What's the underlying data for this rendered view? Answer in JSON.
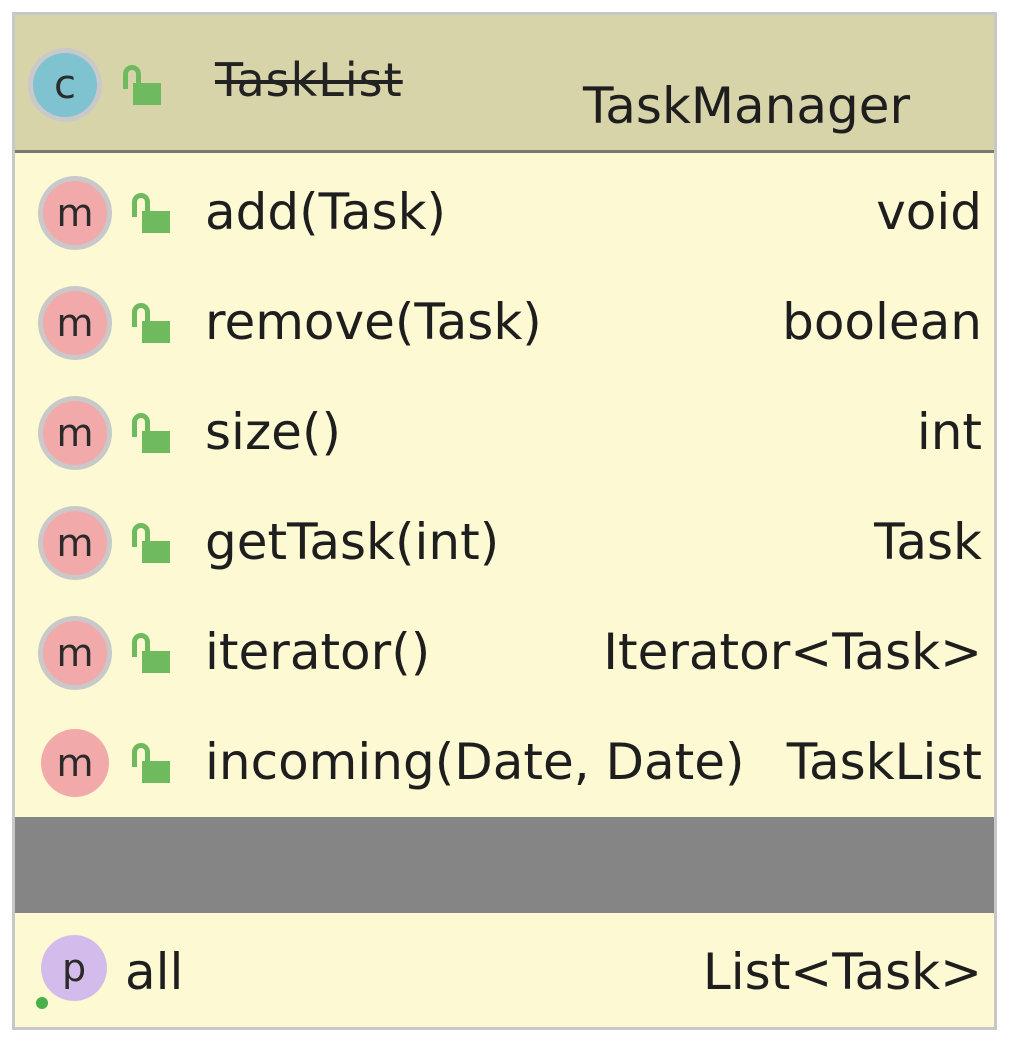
{
  "header": {
    "kind_letter": "c",
    "old_name": "TaskList",
    "name": "TaskManager"
  },
  "methods": [
    {
      "icon": "m",
      "name": "add(Task)",
      "type": "void"
    },
    {
      "icon": "m",
      "name": "remove(Task)",
      "type": "boolean"
    },
    {
      "icon": "m",
      "name": "size()",
      "type": "int"
    },
    {
      "icon": "m",
      "name": "getTask(int)",
      "type": "Task"
    },
    {
      "icon": "m",
      "name": "iterator()",
      "type": "Iterator<Task>"
    },
    {
      "icon": "m",
      "name": "incoming(Date, Date)",
      "type": "TaskList"
    }
  ],
  "properties": [
    {
      "icon": "p",
      "name": "all",
      "type": "List<Task>"
    }
  ],
  "colors": {
    "header_bg": "#d8d4a9",
    "body_bg": "#fcf9d3",
    "class_icon": "#7ec3cf",
    "method_icon": "#f2a9a9",
    "property_icon": "#d3bcec",
    "lock": "#6fba5f",
    "divider": "#858585"
  }
}
